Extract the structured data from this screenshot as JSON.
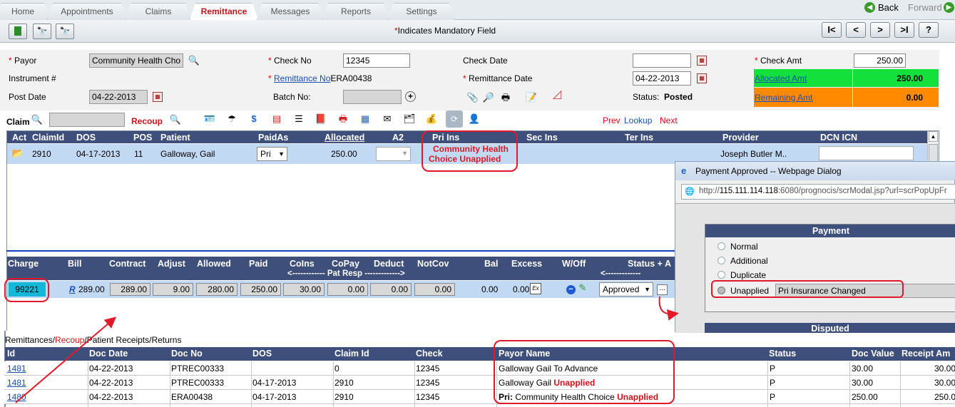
{
  "tabs": [
    "Home",
    "Appointments",
    "Claims",
    "Remittance",
    "Messages",
    "Reports",
    "Settings"
  ],
  "active_tab": "Remittance",
  "nav": {
    "back": "Back",
    "forward": "Forward"
  },
  "toolbar": {
    "mandatory_note": "Indicates Mandatory Field",
    "nav_first": "I<",
    "nav_prev": "<",
    "nav_next": ">",
    "nav_last": ">I",
    "help": "?"
  },
  "form": {
    "payor_label": "Payor",
    "payor_value": "Community Health Cho",
    "instrument_label": "Instrument #",
    "post_date_label": "Post Date",
    "post_date_value": "04-22-2013",
    "check_no_label": "Check No",
    "check_no_value": "12345",
    "remittance_no_label": "Remittance No",
    "remittance_no_value": "ERA00438",
    "batch_no_label": "Batch No:",
    "check_date_label": "Check Date",
    "check_date_value": "",
    "remittance_date_label": "Remittance Date",
    "remittance_date_value": "04-22-2013",
    "status_label": "Status:",
    "status_value": "Posted",
    "check_amt_label": "Check Amt",
    "check_amt_value": "250.00",
    "allocated_amt_label": "Allocated Amt",
    "allocated_amt_value": "250.00",
    "remaining_amt_label": "Remaining Amt",
    "remaining_amt_value": "0.00",
    "colors": {
      "allocated": "#13e03a",
      "remaining": "#ff8a00"
    }
  },
  "claimbar": {
    "claim_label": "Claim",
    "recoup_label": "Recoup",
    "prev": "Prev",
    "lookup": "Lookup",
    "next": "Next"
  },
  "claims_table": {
    "headers": [
      "Act",
      "ClaimId",
      "DOS",
      "POS",
      "Patient",
      "PaidAs",
      "Allocated",
      "A2",
      "Pri Ins",
      "Sec Ins",
      "Ter Ins",
      "Provider",
      "DCN ICN"
    ],
    "row": {
      "claim_id": "2910",
      "dos": "04-17-2013",
      "pos": "11",
      "patient": "Galloway, Gail",
      "paid_as": "Pri",
      "allocated": "250.00",
      "pri_ins_line1": "Community Health",
      "pri_ins_line2": "Choice Unapplied",
      "provider": "Joseph Butler M.."
    }
  },
  "charge_table": {
    "headers": [
      "Charge",
      "Bill",
      "Contract",
      "Adjust",
      "Allowed",
      "Paid",
      "CoIns",
      "CoPay",
      "Deduct",
      "NotCov",
      "Bal",
      "Excess",
      "W/Off",
      "Status + A"
    ],
    "pat_resp": "<------------ Pat Resp ------------->",
    "status_sub": "<-------------",
    "row": {
      "charge": "99221",
      "bill_link": "R",
      "bill": "289.00",
      "contract": "289.00",
      "adjust": "9.00",
      "allowed": "280.00",
      "paid": "250.00",
      "coins": "30.00",
      "copay": "0.00",
      "deduct": "0.00",
      "notcov": "0.00",
      "bal": "0.00",
      "excess": "0.00",
      "status": "Approved",
      "more": "..."
    }
  },
  "dialog": {
    "title": "Payment Approved -- Webpage Dialog",
    "url_prefix": "http://",
    "url_host": "115.111.114.118",
    "url_rest": ":6080/prognocis/scrModal.jsp?url=scrPopUpFr",
    "payment_header": "Payment",
    "options": [
      "Normal",
      "Additional",
      "Duplicate",
      "Unapplied"
    ],
    "unapplied_reason": "Pri  Insurance Changed",
    "disputed_header": "Disputed"
  },
  "bottom": {
    "section_pre": "Remittances/",
    "section_recoup": "Recoup",
    "section_post": "/Patient Receipts/Returns",
    "headers": [
      "Id",
      "Doc Date",
      "Doc No",
      "DOS",
      "Claim Id",
      "Check",
      "Payor Name",
      "Status",
      "Doc Value",
      "Receipt Am"
    ],
    "rows": [
      {
        "id": "1481",
        "doc_date": "04-22-2013",
        "doc_no": "PTREC00333",
        "dos": "",
        "claim_id": "0",
        "check": "12345",
        "payor_prefix": "",
        "payor": "Galloway Gail To Advance",
        "payor_suffix": "",
        "status": "P",
        "doc_value": "30.00",
        "receipt": "30.00"
      },
      {
        "id": "1481",
        "doc_date": "04-22-2013",
        "doc_no": "PTREC00333",
        "dos": "04-17-2013",
        "claim_id": "2910",
        "check": "12345",
        "payor_prefix": "",
        "payor": "Galloway Gail ",
        "payor_suffix": "Unapplied",
        "status": "P",
        "doc_value": "30.00",
        "receipt": "30.00"
      },
      {
        "id": "1480",
        "doc_date": "04-22-2013",
        "doc_no": "ERA00438",
        "dos": "04-17-2013",
        "claim_id": "2910",
        "check": "12345",
        "payor_prefix": "Pri:",
        "payor": " Community Health Choice ",
        "payor_suffix": "Unapplied",
        "status": "P",
        "doc_value": "250.00",
        "receipt": "250.00"
      }
    ]
  }
}
